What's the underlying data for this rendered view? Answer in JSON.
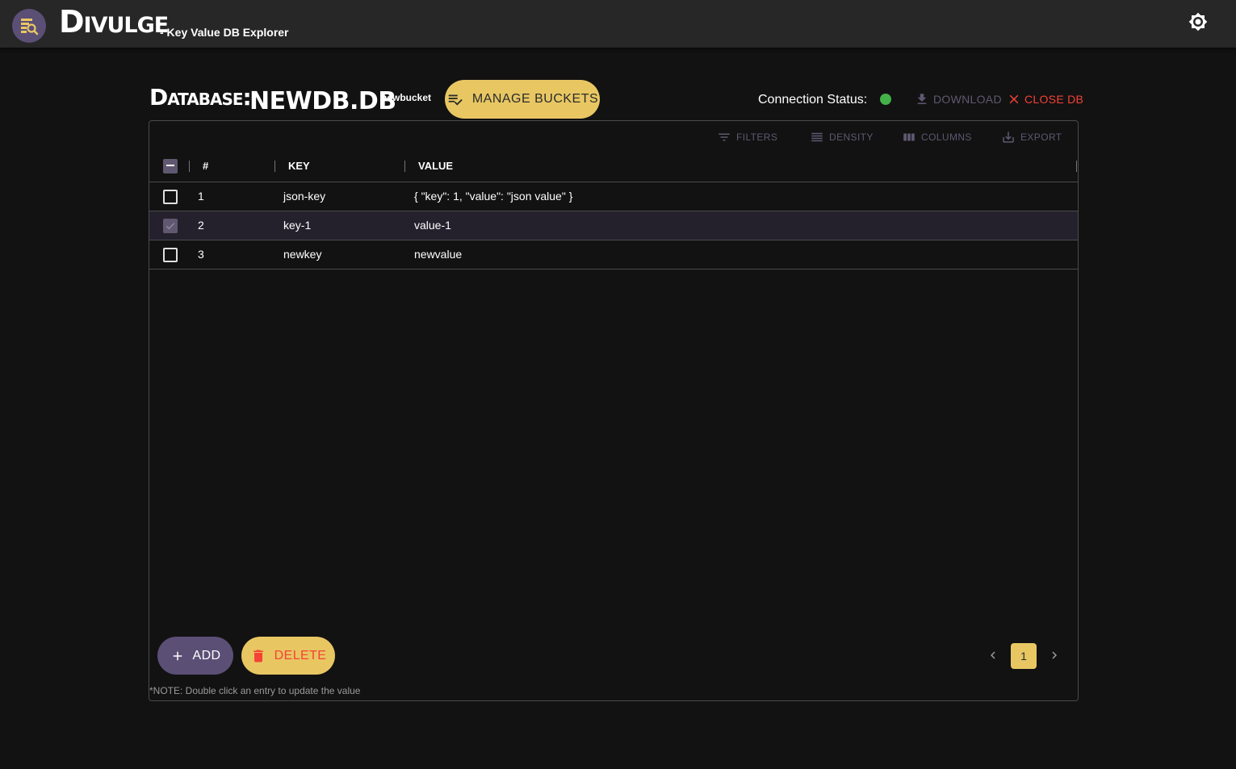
{
  "header": {
    "app_title": "Divulge",
    "app_subtitle": "- Key Value DB Explorer"
  },
  "database": {
    "label": "Database:",
    "name": "NEWDB.DB",
    "bucket": "newbucket",
    "manage_buckets_label": "MANAGE BUCKETS",
    "connection_status_label": "Connection Status:",
    "connection_status_color": "#44b04a",
    "download_label": "DOWNLOAD",
    "close_label": "CLOSE DB"
  },
  "toolbar": {
    "filters": "FILTERS",
    "density": "DENSITY",
    "columns": "COLUMNS",
    "export": "EXPORT"
  },
  "table": {
    "columns": [
      "#",
      "KEY",
      "VALUE"
    ],
    "rows": [
      {
        "id": "1",
        "key": "json-key",
        "value": "{ \"key\": 1, \"value\": \"json value\" }",
        "selected": false
      },
      {
        "id": "2",
        "key": "key-1",
        "value": "value-1",
        "selected": true
      },
      {
        "id": "3",
        "key": "newkey",
        "value": "newvalue",
        "selected": false
      }
    ]
  },
  "footer": {
    "add_label": "ADD",
    "delete_label": "DELETE",
    "current_page": "1",
    "note": "*NOTE: Double click an entry to update the value"
  },
  "colors": {
    "accent_yellow": "#e8c763",
    "accent_purple": "#5b4f76",
    "danger_red": "#f44336",
    "background": "#121212",
    "appbar": "#272727"
  }
}
